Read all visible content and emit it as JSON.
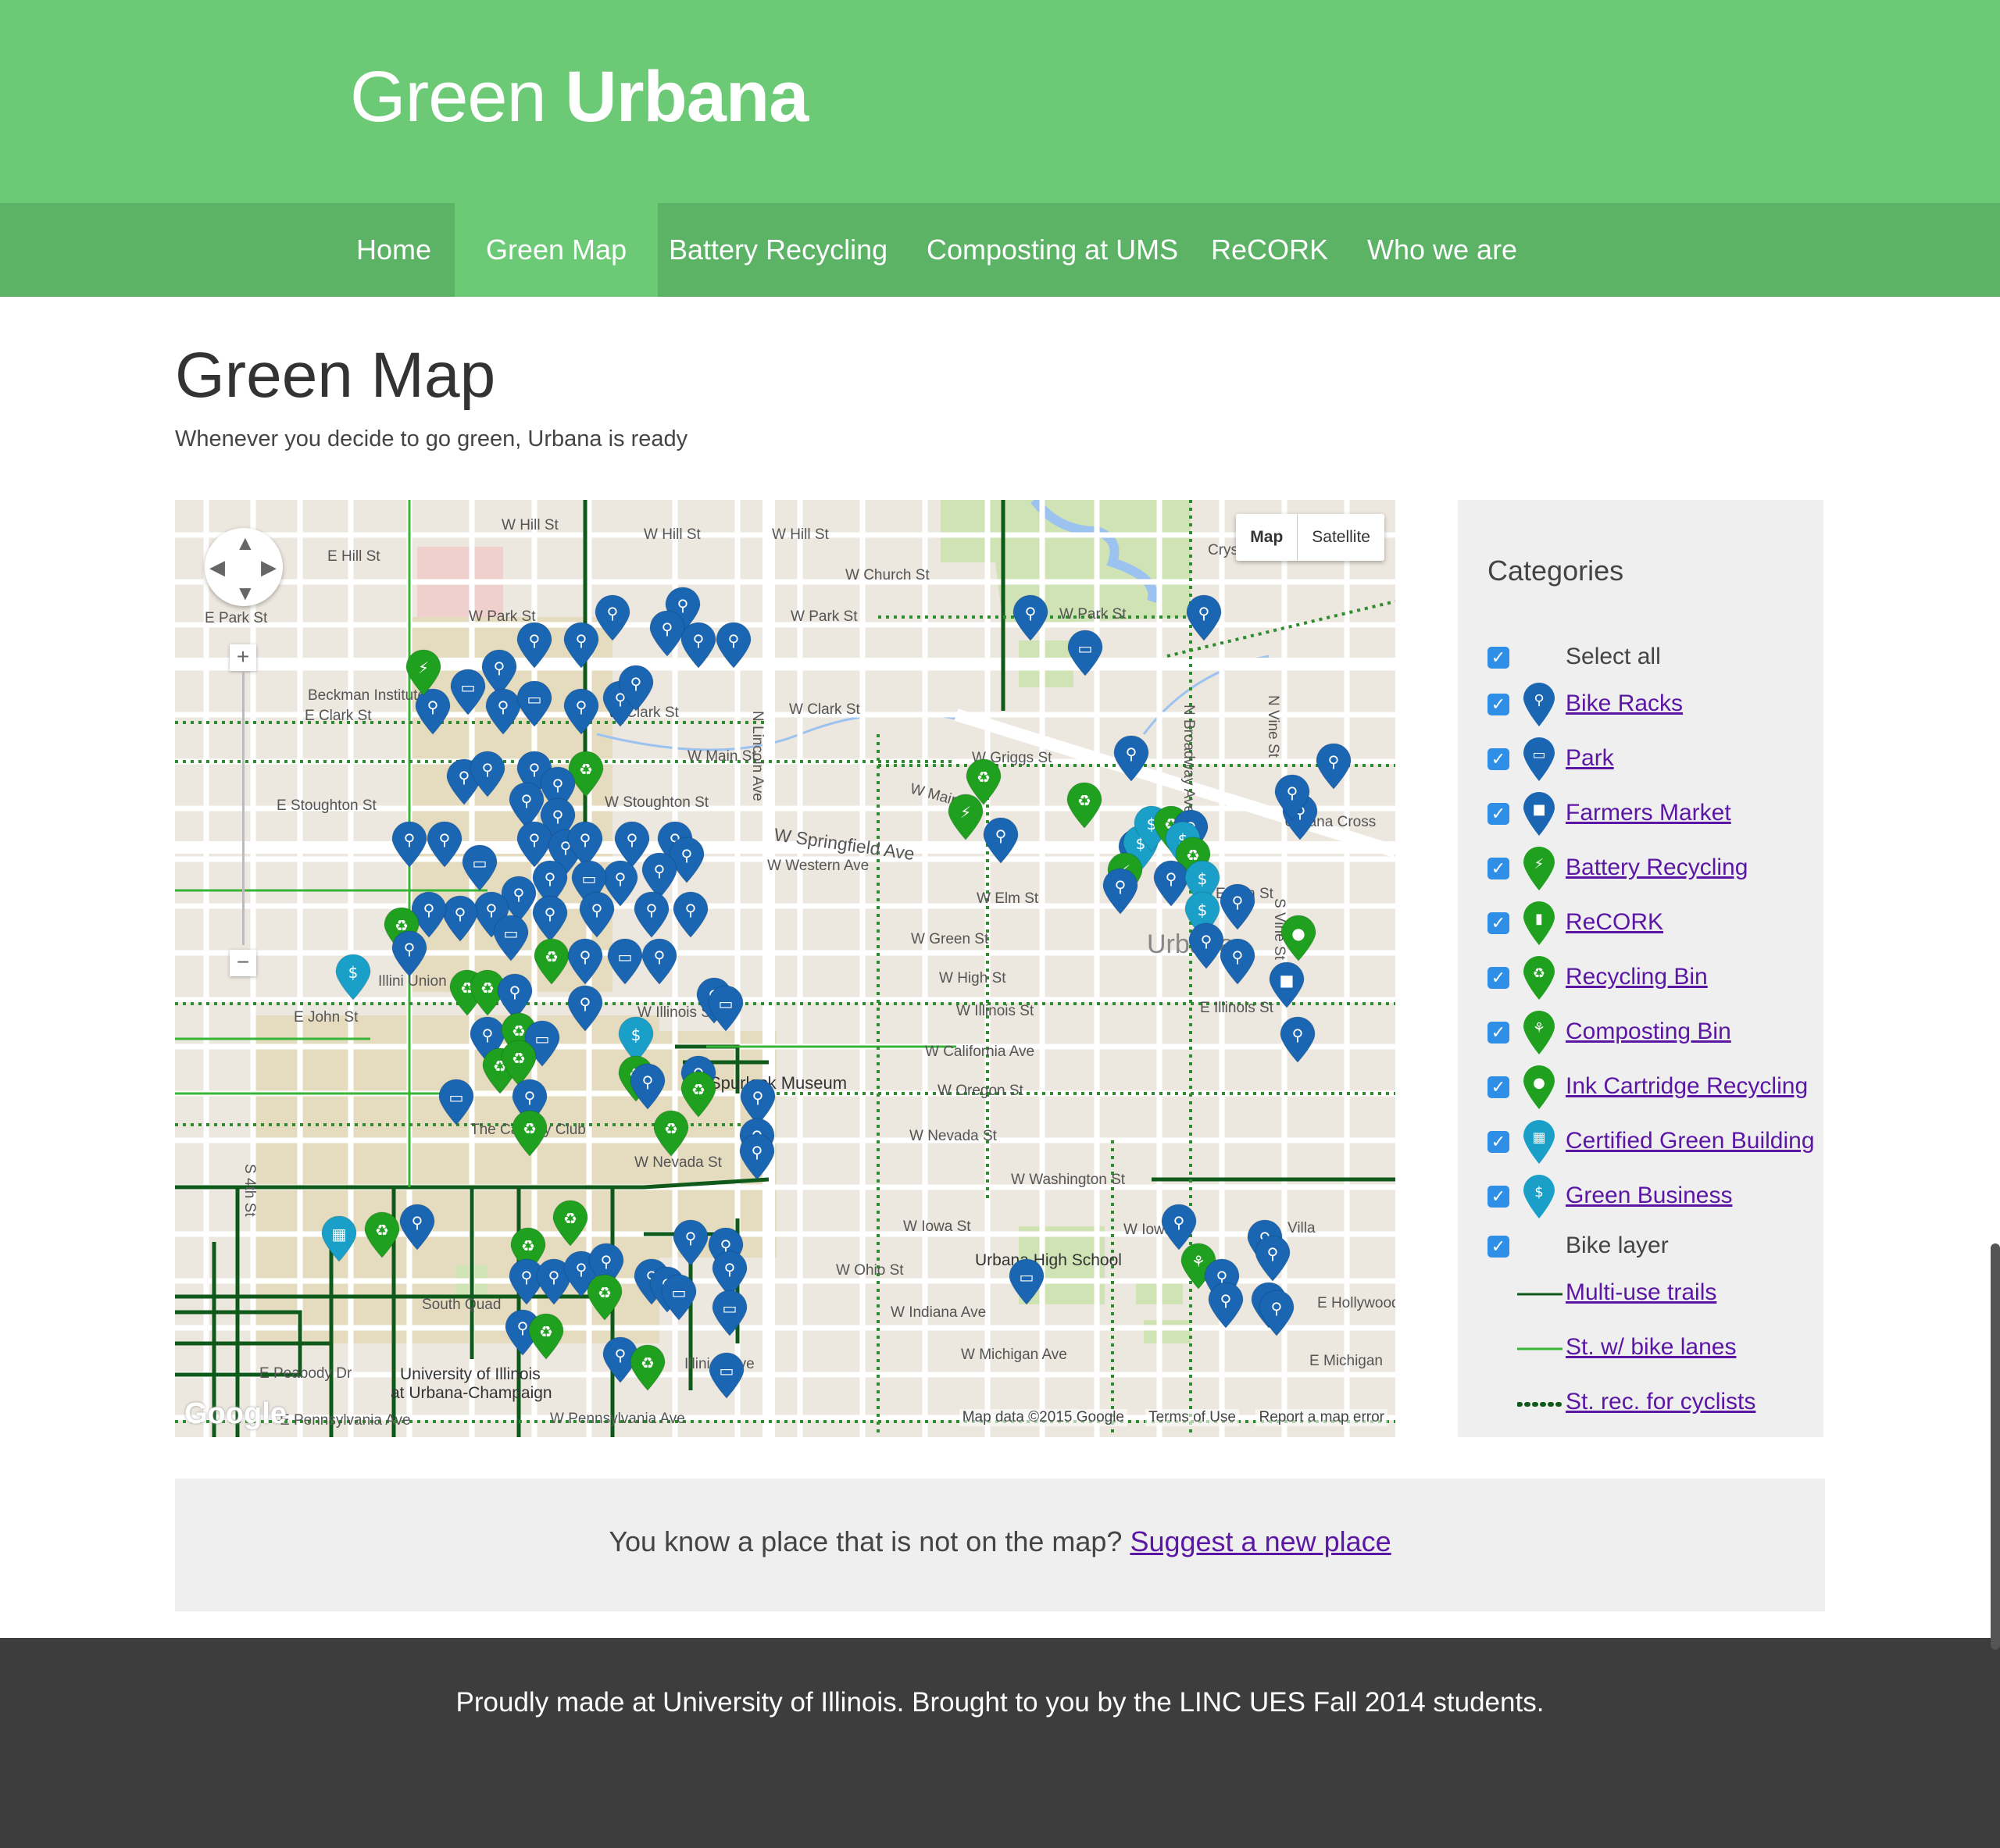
{
  "site": {
    "brand_light": "Green",
    "brand_bold": "Urbana"
  },
  "nav": {
    "items": [
      {
        "label": "Home"
      },
      {
        "label": "Green Map"
      },
      {
        "label": "Battery Recycling"
      },
      {
        "label": "Composting at UMS"
      },
      {
        "label": "ReCORK"
      },
      {
        "label": "Who we are"
      }
    ]
  },
  "page": {
    "title": "Green Map",
    "subtitle": "Whenever you decide to go green, Urbana is ready"
  },
  "map": {
    "type_map": "Map",
    "type_satellite": "Satellite",
    "zoom_in": "+",
    "zoom_out": "−",
    "attribution": "Map data ©2015 Google",
    "terms": "Terms of Use",
    "report": "Report a map error",
    "logo": "Google",
    "labels": {
      "w_hill_st": "W Hill St",
      "w_hill_st2": "W Hill St",
      "e_hill_st": "E Hill St",
      "w_park_st": "W Park St",
      "e_park_st": "E Park St",
      "w_church_st": "W Church St",
      "crystal_lake": "Crystal Lake",
      "w_park_st2": "W Park St",
      "beckman": "Beckman Institute",
      "e_clark_st": "E Clark St",
      "w_clark_st": "W Clark St",
      "w_clark_st2": "W Clark St",
      "w_main_st": "W Main St",
      "e_stoughton": "E Stoughton St",
      "w_stoughton": "W Stoughton St",
      "w_griggs": "W Griggs St",
      "w_main_st2": "W Main St",
      "w_springfield": "W Springfield Ave",
      "w_western": "W Western Ave",
      "w_elm": "W Elm St",
      "e_elm": "E Elm St",
      "w_green": "W Green St",
      "w_high": "W High St",
      "urbana": "Urbana",
      "illini_union": "Illini Union",
      "e_john": "E John St",
      "w_illinois": "W Illinois St",
      "w_illinois2": "W Illinois St",
      "e_illinois": "E Illinois St",
      "w_california": "W California Ave",
      "spurlock": "Spurlock Museum",
      "w_oregon": "W Oregon St",
      "canopy": "The Canopy Club",
      "w_nevada": "W Nevada St",
      "w_nevada2": "W Nevada St",
      "w_washington": "W Washington St",
      "w_iowa": "W Iowa St",
      "w_iowa2": "W Iowa St",
      "w_ohio": "W Ohio St",
      "uhs": "Urbana High School",
      "e_hollywood": "E Hollywood",
      "south_quad": "South Quad",
      "w_indiana": "W Indiana Ave",
      "w_michigan": "W Michigan Ave",
      "e_michigan": "E Michigan",
      "e_peabody": "E Peabody Dr",
      "uiuc1": "University of Illinois",
      "uiuc2": "at Urbana-Champaign",
      "illini_grove": "Illini Grove",
      "e_pennsylvania": "E Pennsylvania Ave",
      "w_pennsylvania": "W Pennsylvania Ave",
      "n_lincoln": "N Lincoln Ave",
      "n_vine": "N Vine St",
      "s_vine": "S Vine St",
      "s_4th": "S 4th St",
      "n_broadway": "N Broadway Ave",
      "urbana_cross": "Urbana Cross",
      "villa": "Villa"
    }
  },
  "sidebar": {
    "title": "Categories",
    "select_all": "Select all",
    "categories": [
      {
        "label": "Bike Racks",
        "color": "#1a66b3",
        "icon": "bike-icon"
      },
      {
        "label": "Park",
        "color": "#1a66b3",
        "icon": "bench-icon"
      },
      {
        "label": "Farmers Market",
        "color": "#1a66b3",
        "icon": "bag-icon"
      },
      {
        "label": "Battery Recycling",
        "color": "#1fa01f",
        "icon": "bolt-icon"
      },
      {
        "label": "ReCORK",
        "color": "#1fa01f",
        "icon": "cork-icon"
      },
      {
        "label": "Recycling Bin",
        "color": "#1fa01f",
        "icon": "recycle-icon"
      },
      {
        "label": "Composting Bin",
        "color": "#1fa01f",
        "icon": "sprout-icon"
      },
      {
        "label": "Ink Cartridge Recycling",
        "color": "#1fa01f",
        "icon": "drop-icon"
      },
      {
        "label": "Certified Green Building",
        "color": "#1aa0c8",
        "icon": "building-icon"
      },
      {
        "label": "Green Business",
        "color": "#1aa0c8",
        "icon": "dollar-icon"
      }
    ],
    "bike_layer": "Bike layer",
    "bike_lines": [
      {
        "label": "Multi-use trails",
        "style": "solid-dark"
      },
      {
        "label": "St. w/ bike lanes",
        "style": "solid-light"
      },
      {
        "label": "St. rec. for cyclists",
        "style": "dotted"
      }
    ]
  },
  "suggest": {
    "text": "You know a place that is not on the map?",
    "link": "Suggest a new place"
  },
  "footer": {
    "text": "Proudly made at University of Illinois. Brought to you by the LINC UES Fall 2014 students."
  }
}
